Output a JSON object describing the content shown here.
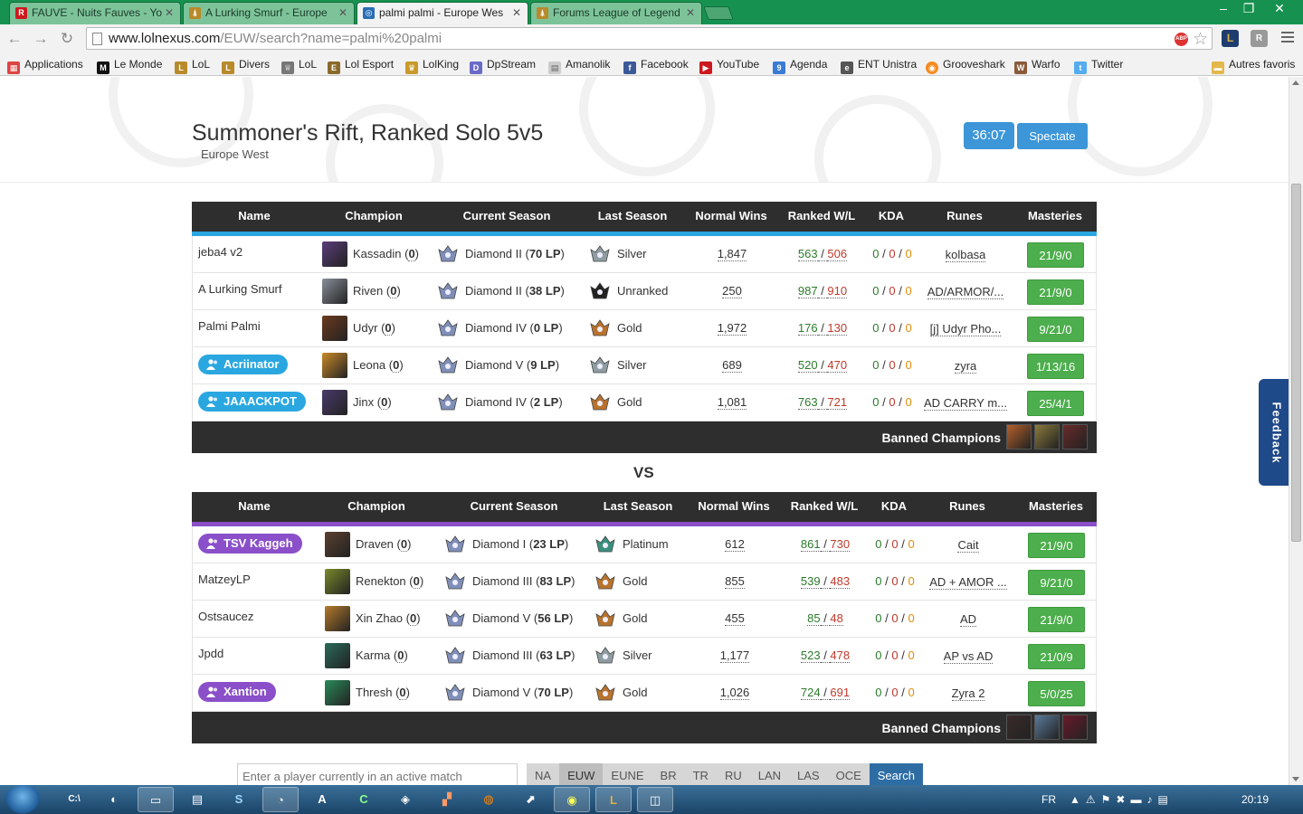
{
  "browser": {
    "tabs": [
      {
        "title": "FAUVE - Nuits Fauves - Yo",
        "active": false
      },
      {
        "title": "A Lurking Smurf - Europe",
        "active": false
      },
      {
        "title": "palmi palmi - Europe Wes",
        "active": true
      },
      {
        "title": "Forums League of Legend",
        "active": false
      }
    ],
    "url_host": "www.lolnexus.com",
    "url_path": "/EUW/search?name=palmi%20palmi",
    "bookmarks": [
      "Applications",
      "Le Monde",
      "LoL",
      "Divers",
      "LoL",
      "Lol Esport",
      "LolKing",
      "DpStream",
      "Amanolik",
      "Facebook",
      "YouTube",
      "Agenda",
      "ENT Unistra",
      "Grooveshark",
      "Warfo",
      "Twitter"
    ],
    "other_bookmarks": "Autres favoris"
  },
  "match": {
    "title": "Summoner's Rift, Ranked Solo 5v5",
    "region": "Europe West",
    "timer": "36:07",
    "spectate_label": "Spectate",
    "vs_label": "VS"
  },
  "columns": [
    "Name",
    "Champion",
    "Current Season",
    "Last Season",
    "Normal Wins",
    "Ranked W/L",
    "KDA",
    "Runes",
    "Masteries"
  ],
  "banned_label": "Banned Champions",
  "teams": [
    {
      "accent": "#2aa7e0",
      "players": [
        {
          "name": "jeba4 v2",
          "friend": false,
          "champion": "Kassadin",
          "champ_games": "0",
          "current_tier": "Diamond II",
          "current_lp": "70 LP",
          "last_season": "Silver",
          "normal_wins": "1,847",
          "ranked_w": "563",
          "ranked_l": "506",
          "kda": [
            "0",
            "0",
            "0"
          ],
          "runes": "kolbasa",
          "masteries": "21/9/0"
        },
        {
          "name": "A Lurking Smurf",
          "friend": false,
          "champion": "Riven",
          "champ_games": "0",
          "current_tier": "Diamond II",
          "current_lp": "38 LP",
          "last_season": "Unranked",
          "normal_wins": "250",
          "ranked_w": "987",
          "ranked_l": "910",
          "kda": [
            "0",
            "0",
            "0"
          ],
          "runes": "AD/ARMOR/...",
          "masteries": "21/9/0"
        },
        {
          "name": "Palmi Palmi",
          "friend": false,
          "champion": "Udyr",
          "champ_games": "0",
          "current_tier": "Diamond IV",
          "current_lp": "0 LP",
          "last_season": "Gold",
          "normal_wins": "1,972",
          "ranked_w": "176",
          "ranked_l": "130",
          "kda": [
            "0",
            "0",
            "0"
          ],
          "runes": "[j] Udyr Pho...",
          "masteries": "9/21/0"
        },
        {
          "name": "Acriinator",
          "friend": true,
          "champion": "Leona",
          "champ_games": "0",
          "current_tier": "Diamond V",
          "current_lp": "9 LP",
          "last_season": "Silver",
          "normal_wins": "689",
          "ranked_w": "520",
          "ranked_l": "470",
          "kda": [
            "0",
            "0",
            "0"
          ],
          "runes": "zyra",
          "masteries": "1/13/16"
        },
        {
          "name": "JAAACKPOT",
          "friend": true,
          "champion": "Jinx",
          "champ_games": "0",
          "current_tier": "Diamond IV",
          "current_lp": "2 LP",
          "last_season": "Gold",
          "normal_wins": "1,081",
          "ranked_w": "763",
          "ranked_l": "721",
          "kda": [
            "0",
            "0",
            "0"
          ],
          "runes": "AD CARRY m...",
          "masteries": "25/4/1"
        }
      ]
    },
    {
      "accent": "#8a4fc9",
      "players": [
        {
          "name": "TSV Kaggeh",
          "friend": true,
          "champion": "Draven",
          "champ_games": "0",
          "current_tier": "Diamond I",
          "current_lp": "23 LP",
          "last_season": "Platinum",
          "normal_wins": "612",
          "ranked_w": "861",
          "ranked_l": "730",
          "kda": [
            "0",
            "0",
            "0"
          ],
          "runes": "Cait",
          "masteries": "21/9/0"
        },
        {
          "name": "MatzeyLP",
          "friend": false,
          "champion": "Renekton",
          "champ_games": "0",
          "current_tier": "Diamond III",
          "current_lp": "83 LP",
          "last_season": "Gold",
          "normal_wins": "855",
          "ranked_w": "539",
          "ranked_l": "483",
          "kda": [
            "0",
            "0",
            "0"
          ],
          "runes": "AD + AMOR ...",
          "masteries": "9/21/0"
        },
        {
          "name": "Ostsaucez",
          "friend": false,
          "champion": "Xin Zhao",
          "champ_games": "0",
          "current_tier": "Diamond V",
          "current_lp": "56 LP",
          "last_season": "Gold",
          "normal_wins": "455",
          "ranked_w": "85",
          "ranked_l": "48",
          "kda": [
            "0",
            "0",
            "0"
          ],
          "runes": "AD",
          "masteries": "21/9/0"
        },
        {
          "name": "Jpdd",
          "friend": false,
          "champion": "Karma",
          "champ_games": "0",
          "current_tier": "Diamond III",
          "current_lp": "63 LP",
          "last_season": "Silver",
          "normal_wins": "1,177",
          "ranked_w": "523",
          "ranked_l": "478",
          "kda": [
            "0",
            "0",
            "0"
          ],
          "runes": "AP vs AD",
          "masteries": "21/0/9"
        },
        {
          "name": "Xantion",
          "friend": true,
          "champion": "Thresh",
          "champ_games": "0",
          "current_tier": "Diamond V",
          "current_lp": "70 LP",
          "last_season": "Gold",
          "normal_wins": "1,026",
          "ranked_w": "724",
          "ranked_l": "691",
          "kda": [
            "0",
            "0",
            "0"
          ],
          "runes": "Zyra 2",
          "masteries": "5/0/25"
        }
      ]
    }
  ],
  "search": {
    "placeholder": "Enter a player currently in an active match",
    "regions": [
      "NA",
      "EUW",
      "EUNE",
      "BR",
      "TR",
      "RU",
      "LAN",
      "LAS",
      "OCE"
    ],
    "selected_region": "EUW",
    "search_label": "Search"
  },
  "feedback_label": "Feedback",
  "taskbar": {
    "lang": "FR",
    "clock": "20:19"
  }
}
